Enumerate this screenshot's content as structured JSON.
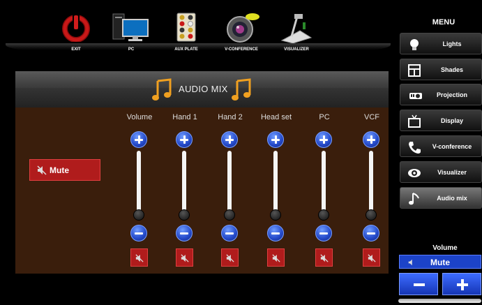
{
  "sources": [
    {
      "id": "exit",
      "label": "EXIT",
      "icon": "power-icon"
    },
    {
      "id": "pc",
      "label": "PC",
      "icon": "computer-icon"
    },
    {
      "id": "aux",
      "label": "AUX PLATE",
      "icon": "aux-plate-icon"
    },
    {
      "id": "vconf",
      "label": "V-CONFERENCE",
      "icon": "camera-icon"
    },
    {
      "id": "visualizer",
      "label": "VISUALIZER",
      "icon": "document-camera-icon"
    }
  ],
  "panel": {
    "title": "AUDIO MIX",
    "mute_label": "Mute",
    "channels": [
      {
        "name": "Volume"
      },
      {
        "name": "Hand 1"
      },
      {
        "name": "Hand 2"
      },
      {
        "name": "Head set"
      },
      {
        "name": "PC"
      },
      {
        "name": "VCF"
      }
    ]
  },
  "menu": {
    "title": "MENU",
    "items": [
      {
        "label": "Lights",
        "icon": "light-bulb-icon",
        "active": false
      },
      {
        "label": "Shades",
        "icon": "window-shade-icon",
        "active": false
      },
      {
        "label": "Projection",
        "icon": "projector-icon",
        "active": false
      },
      {
        "label": "Display",
        "icon": "tv-icon",
        "active": false
      },
      {
        "label": "V-conference",
        "icon": "phone-icon",
        "active": false
      },
      {
        "label": "Visualizer",
        "icon": "eye-icon",
        "active": false
      },
      {
        "label": "Audio mix",
        "icon": "music-note-icon",
        "active": true
      }
    ]
  },
  "volume": {
    "title": "Volume",
    "mute_label": "Mute"
  },
  "colors": {
    "panel_bg": "#3a1e0c",
    "mute_red": "#b01c1c",
    "button_blue": "#2348c8",
    "menu_active": "#777777"
  }
}
